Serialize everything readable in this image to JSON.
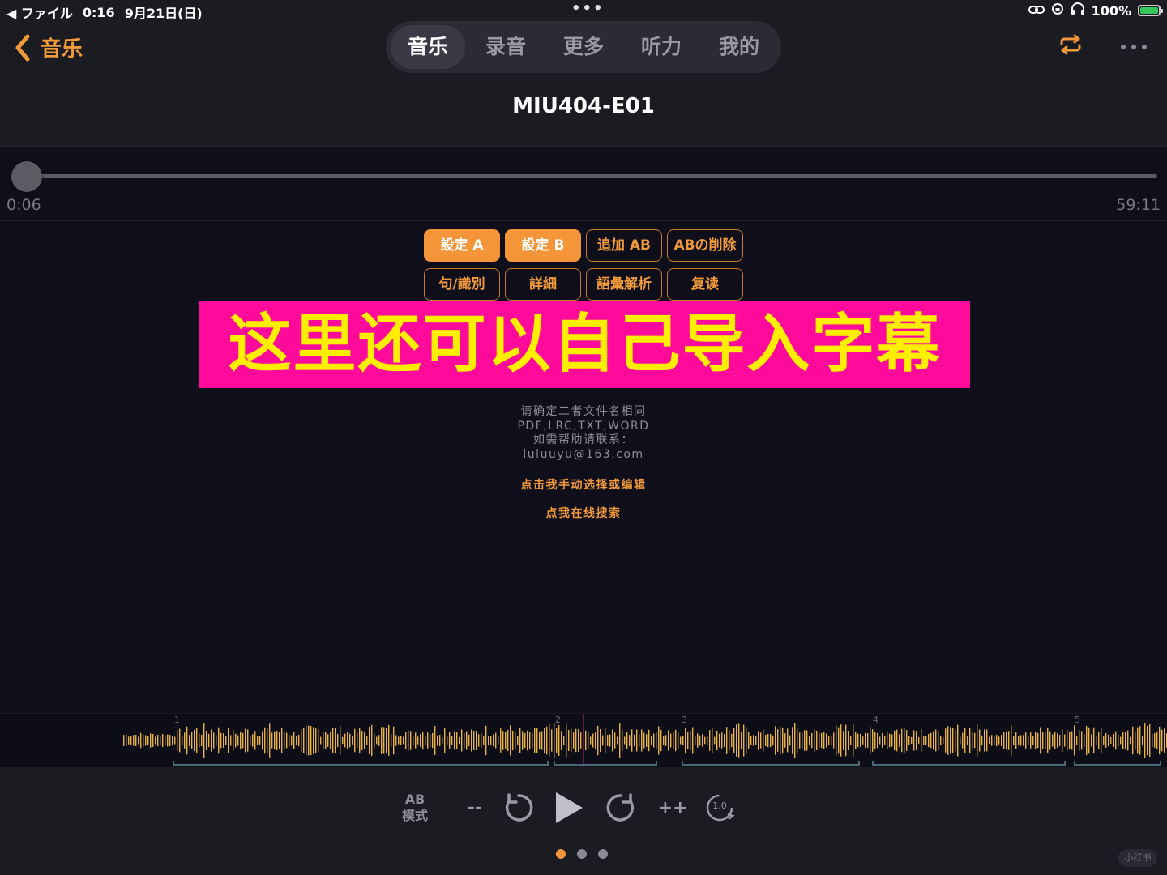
{
  "status": {
    "back_app": "ファイル",
    "time": "0:16",
    "date": "9月21日(日)",
    "battery": "100%",
    "battery_level": 1.0
  },
  "header": {
    "back_label": "音乐",
    "tabs": [
      {
        "label": "音乐",
        "active": true
      },
      {
        "label": "录音",
        "active": false
      },
      {
        "label": "更多",
        "active": false
      },
      {
        "label": "听力",
        "active": false
      },
      {
        "label": "我的",
        "active": false
      }
    ],
    "title": "MIU404-E01"
  },
  "progress": {
    "current": "0:06",
    "total": "59:11",
    "fraction": 0.0017
  },
  "ab_buttons": [
    {
      "label": "設定 A",
      "filled": true
    },
    {
      "label": "設定 B",
      "filled": true
    },
    {
      "label": "追加 AB",
      "filled": false
    },
    {
      "label": "ABの削除",
      "filled": false
    },
    {
      "label": "句/識別",
      "filled": false
    },
    {
      "label": "詳細",
      "filled": false
    },
    {
      "label": "語彙解析",
      "filled": false
    },
    {
      "label": "复读",
      "filled": false
    }
  ],
  "banner": "这里还可以自己导入字幕",
  "info": {
    "lines": [
      "请确定二者文件名相同",
      "PDF,LRC,TXT,WORD",
      "如需帮助请联系：",
      "luluuyu@163.com"
    ],
    "link_manual": "点击我手动选择或编辑",
    "link_search": "点我在线搜索"
  },
  "waveform": {
    "markers": [
      "1",
      "2",
      "3",
      "4",
      "5"
    ],
    "color": "#e8b24a"
  },
  "controls": {
    "ab_mode_top": "AB",
    "ab_mode_bottom": "模式",
    "minus": "--",
    "plus": "++",
    "speed": "1.0"
  },
  "page_indicator": {
    "count": 3,
    "active": 0
  },
  "watermark": "小红书",
  "colors": {
    "accent": "#f4953a",
    "banner_bg": "#ff0a9a",
    "banner_text": "#ffee00"
  }
}
